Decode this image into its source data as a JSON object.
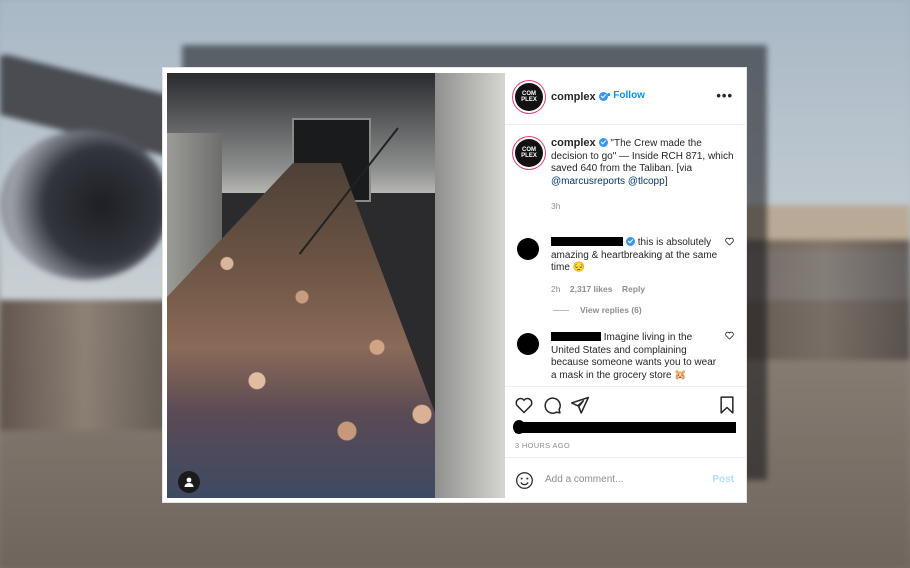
{
  "post": {
    "username": "complex",
    "follow_label": "Follow",
    "separator": "•",
    "more_label": "•••",
    "avatar_text": "COM PLEX",
    "caption": {
      "username": "complex",
      "text_before": "\"The Crew made the decision to go\" — Inside RCH 871, which saved 640 from the Taliban. [via ",
      "mention1": "@marcusreports",
      "mention2": "@tlcopp",
      "text_after": "]",
      "time": "3h"
    },
    "comments": [
      {
        "text": "this is absolutely amazing & heartbreaking at the same time 😔",
        "time": "2h",
        "likes": "2,317 likes",
        "reply": "Reply",
        "view_replies": "View replies (6)"
      },
      {
        "text": "Imagine living in the United States and complaining because someone wants you to wear a mask in the grocery store 🐹"
      }
    ],
    "timestamp": "3 HOURS AGO",
    "add_comment_placeholder": "Add a comment...",
    "post_button": "Post"
  },
  "colors": {
    "accent": "#0095f6",
    "verified": "#3897f0",
    "muted": "#8e8e8e"
  },
  "icons": [
    "more-options-icon",
    "verified-badge-icon",
    "heart-icon",
    "comment-icon",
    "share-icon",
    "bookmark-icon",
    "emoji-icon",
    "user-tag-icon"
  ]
}
